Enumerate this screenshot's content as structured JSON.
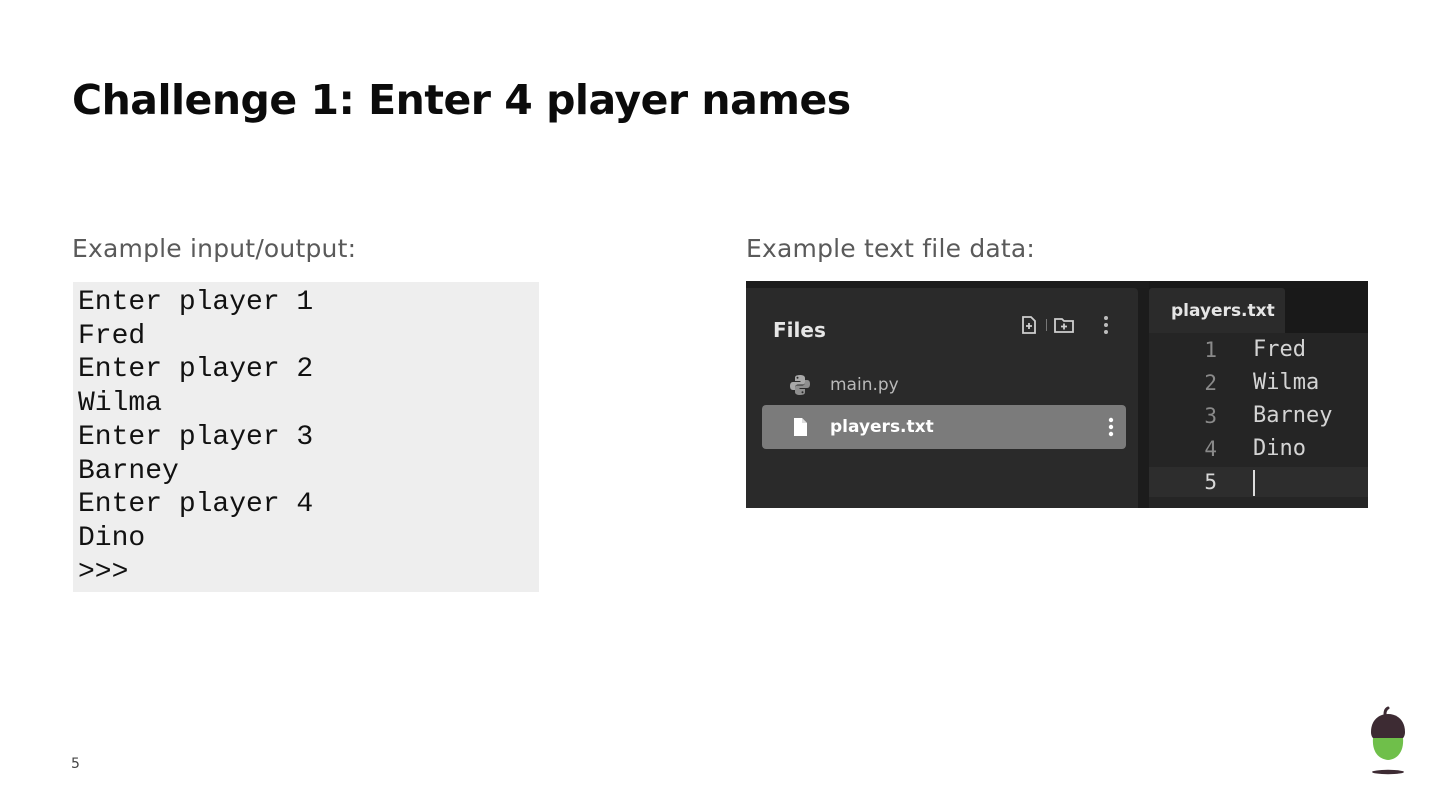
{
  "slide": {
    "title": "Challenge 1: Enter 4 player names",
    "page_number": "5"
  },
  "left_section": {
    "label": "Example input/output:",
    "console_lines": [
      "Enter player 1",
      "Fred",
      "Enter player 2",
      "Wilma",
      "Enter player 3",
      "Barney",
      "Enter player 4",
      "Dino",
      ">>>"
    ]
  },
  "right_section": {
    "label": "Example text file data:",
    "ide": {
      "files_header": "Files",
      "header_icons": [
        "new-file-icon",
        "new-folder-icon",
        "more-vert-icon"
      ],
      "files": [
        {
          "name": "main.py",
          "icon": "python-icon",
          "selected": false
        },
        {
          "name": "players.txt",
          "icon": "file-icon",
          "selected": true
        }
      ],
      "tab_label": "players.txt",
      "editor_lines": [
        {
          "number": "1",
          "text": "Fred"
        },
        {
          "number": "2",
          "text": "Wilma"
        },
        {
          "number": "3",
          "text": "Barney"
        },
        {
          "number": "4",
          "text": "Dino"
        },
        {
          "number": "5",
          "text": ""
        }
      ],
      "current_line": "5"
    }
  },
  "colors": {
    "console_bg": "#eeeeee",
    "ide_bg": "#1c1c1c",
    "selected_file_bg": "#7b7b7b",
    "logo_green": "#6fbf4a",
    "logo_dark": "#3d2b33"
  },
  "logo": {
    "icon": "acorn-logo-icon"
  }
}
